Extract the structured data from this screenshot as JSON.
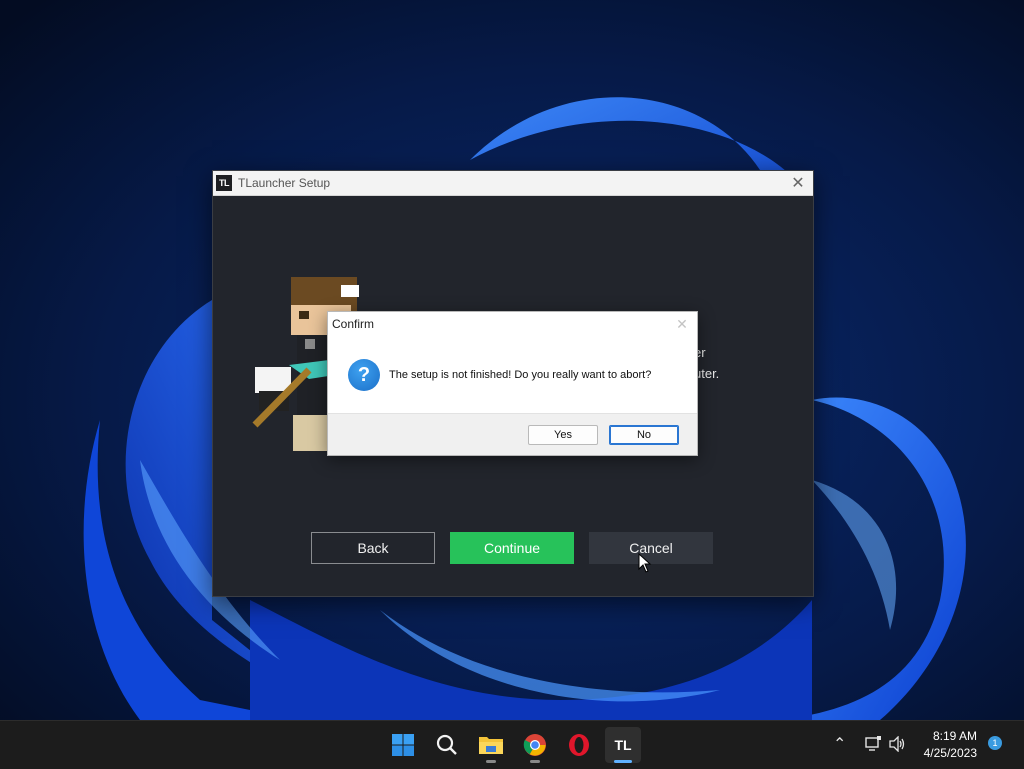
{
  "installer": {
    "title": "TLauncher Setup",
    "logo_text": "TL",
    "background_text_line1": "er",
    "background_text_line2": "uter.",
    "buttons": {
      "back": "Back",
      "continue": "Continue",
      "cancel": "Cancel"
    },
    "accent_color": "#27c25a"
  },
  "confirm_dialog": {
    "title": "Confirm",
    "message": "The setup is not finished! Do you really want to abort?",
    "icon": "question-icon",
    "buttons": {
      "yes": "Yes",
      "no": "No"
    }
  },
  "taskbar": {
    "apps": [
      {
        "name": "start-icon"
      },
      {
        "name": "search-icon"
      },
      {
        "name": "file-explorer-icon"
      },
      {
        "name": "chrome-icon"
      },
      {
        "name": "opera-icon"
      },
      {
        "name": "tlauncher-icon",
        "label": "TL"
      }
    ],
    "clock": {
      "time": "8:19 AM",
      "date": "4/25/2023"
    },
    "notification_count": "1"
  }
}
